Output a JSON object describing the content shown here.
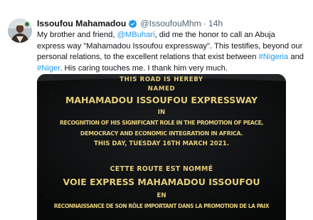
{
  "tweet": {
    "author_name": "Issoufou Mahamadou",
    "handle": "@IssoufouMhm",
    "separator": "·",
    "time": "14h",
    "body": {
      "line1_pre": "My brother and friend, ",
      "mention": "@MBuhari",
      "line1_post": ", did me the honor to call an Abuja",
      "line2": "express way \"Mahamadou Issoufou expressway\". This testifies, beyond our",
      "line3_pre": "personal relations, to the excellent relations that exist between ",
      "hashtag1": "#Nigeria",
      "line3_post": " and",
      "hashtag2": "#Niger",
      "line4_post": ". His caring touches me. I thank him very much."
    }
  },
  "plaque": {
    "l1": "This road is hereby",
    "l2": "named",
    "l3": "Mahamadou Issoufou Expressway",
    "l4": "in",
    "l5": "Recognition of his significant role in the promotion of peace,",
    "l6": "Democracy and economic integration in  Africa.",
    "l7": "This day, Tuesday 16th March 2021.",
    "l8": "Cette route est nommé",
    "l9": "Voie Express Mahamadou Issoufou",
    "l10": "en",
    "l11": "Reconnaissance de son rôle important dans la promotion de la paix"
  },
  "colors": {
    "accent_link": "#1d9bf0",
    "verified": "#1d9bf0",
    "plaque_text": "#e4cd7a",
    "plaque_bg": "#0d0f10"
  }
}
